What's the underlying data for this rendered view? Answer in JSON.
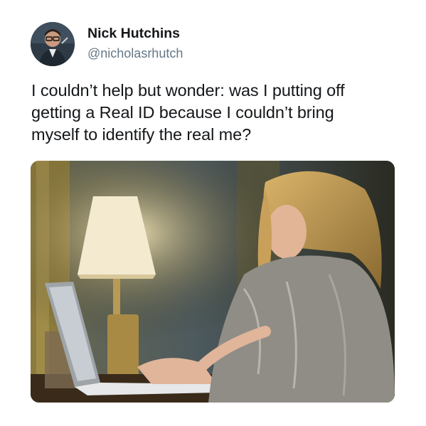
{
  "author": {
    "name": "Nick Hutchins",
    "handle": "@nicholasrhutch"
  },
  "tweet": {
    "lines": [
      "I couldn’t help but wonder: was I putting off",
      "getting a Real ID because I couldn’t bring",
      "myself to identify the real me?"
    ]
  },
  "colors": {
    "name": "#14171a",
    "handle": "#657786",
    "background": "#ffffff"
  },
  "icons": {
    "avatar": "profile-photo",
    "media": "photo-woman-laptop-lamp"
  }
}
